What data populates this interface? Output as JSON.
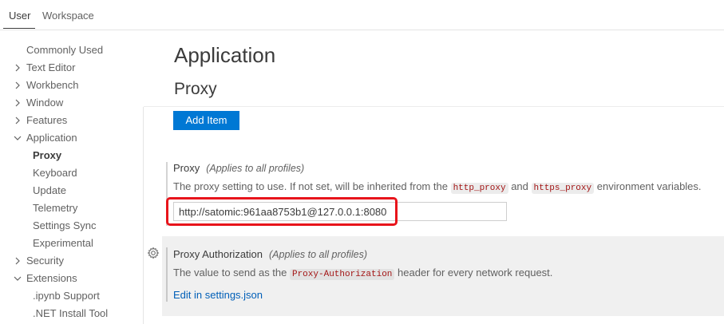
{
  "tabs": [
    {
      "label": "User",
      "active": true
    },
    {
      "label": "Workspace",
      "active": false
    }
  ],
  "tree": {
    "commonly_used": "Commonly Used",
    "text_editor": "Text Editor",
    "workbench": "Workbench",
    "window": "Window",
    "features": "Features",
    "application": "Application",
    "proxy": "Proxy",
    "keyboard": "Keyboard",
    "update": "Update",
    "telemetry": "Telemetry",
    "settings_sync": "Settings Sync",
    "experimental": "Experimental",
    "security": "Security",
    "extensions": "Extensions",
    "ipynb_support": ".ipynb Support",
    "net_install_tool": ".NET Install Tool"
  },
  "main": {
    "section_title": "Application",
    "subsection_title": "Proxy",
    "add_item_label": "Add Item"
  },
  "proxy_setting": {
    "title": "Proxy",
    "scope": "(Applies to all profiles)",
    "desc_before": "The proxy setting to use. If not set, will be inherited from the ",
    "code1": "http_proxy",
    "desc_middle": " and ",
    "code2": "https_proxy",
    "desc_after": " environment variables.",
    "value": "http://satomic:961aa8753b1@127.0.0.1:8080"
  },
  "proxy_auth_setting": {
    "title": "Proxy Authorization",
    "scope": "(Applies to all profiles)",
    "desc_before": "The value to send as the ",
    "code": "Proxy-Authorization",
    "desc_after": " header for every network request.",
    "link": "Edit in settings.json"
  },
  "colors": {
    "accent": "#0078d4",
    "link": "#005fb8",
    "highlight": "#e8141b"
  }
}
